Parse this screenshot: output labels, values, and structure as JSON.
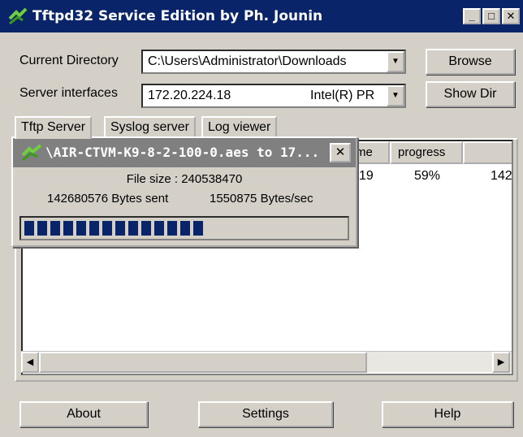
{
  "window": {
    "title": "Tftpd32 Service Edition by Ph. Jounin",
    "controls": {
      "minimize": "_",
      "maximize": "□",
      "close": "✕"
    }
  },
  "current_directory": {
    "label": "Current Directory",
    "value": "C:\\Users\\Administrator\\Downloads",
    "browse_label": "Browse"
  },
  "server_interfaces": {
    "label": "Server interfaces",
    "ip": "172.20.224.18",
    "adapter": "Intel(R) PR",
    "showdir_label": "Show Dir"
  },
  "tabs": [
    {
      "label": "Tftp Server"
    },
    {
      "label": "Syslog server"
    },
    {
      "label": "Log viewer"
    }
  ],
  "transfer_list": {
    "columns": [
      "me",
      "progress",
      ""
    ],
    "rows": [
      {
        "time": "19",
        "progress": "59%",
        "bytes": "142"
      }
    ]
  },
  "transfer_popup": {
    "title": "\\AIR-CTVM-K9-8-2-100-0.aes to 17...",
    "close": "✕",
    "file_size": "File size : 240538470",
    "bytes_sent": "142680576 Bytes sent",
    "rate": "1550875 Bytes/sec",
    "progress_fraction": 0.59
  },
  "bottom_buttons": {
    "about": "About",
    "settings": "Settings",
    "help": "Help"
  },
  "colors": {
    "title_active": "#0a246a",
    "title_inactive": "#808080",
    "face": "#d4d0c8",
    "progress": "#0a246a"
  }
}
